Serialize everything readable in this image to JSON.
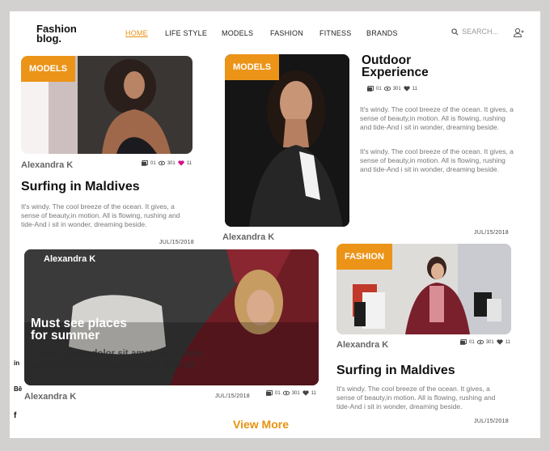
{
  "logo": {
    "line1": "Fashion",
    "line2": "blog."
  },
  "nav": [
    "HOME",
    "LIFE STYLE",
    "MODELS",
    "FASHION",
    "FITNESS",
    "BRANDS"
  ],
  "search": {
    "placeholder": "SEARCH..."
  },
  "colors": {
    "accent": "#eb9418",
    "like": "#d6118c"
  },
  "posts": {
    "p1": {
      "badge": "MODELS",
      "author": "Alexandra K",
      "photos": "01",
      "views": "301",
      "likes": "11",
      "title": "Surfing in Maldives",
      "excerpt": "It's windy. The cool breeze of the ocean. It gives, a sense of beauty,in motion. All is flowing, rushing and tide-And i sit in wonder, dreaming beside.",
      "date": "JUL/15/2018"
    },
    "p2": {
      "badge": "MODELS",
      "author": "Alexandra K",
      "title1": "Outdoor",
      "title2": "Experience",
      "photos": "01",
      "views": "301",
      "likes": "11",
      "excerpt1": "It's windy. The cool breeze of the ocean. It gives, a sense of beauty,in motion. All is flowing, rushing and tide-And i sit in wonder, dreaming beside.",
      "excerpt2": "It's windy. The cool breeze of the ocean. It gives, a sense of beauty,in motion. All is flowing, rushing and tide-And i sit in wonder, dreaming beside.",
      "date": "JUL/15/2018"
    },
    "p3": {
      "overlay_author": "Alexandra K",
      "headline1": "Must see places",
      "headline2": "for summer",
      "lorem1": "Lorem ipsum dolor sit amet consetetur",
      "lorem2": "adipiscing elit nullam aliquea dam sit",
      "author": "Alexandra K",
      "date": "JUL/15/2018",
      "photos": "01",
      "views": "301",
      "likes": "11"
    },
    "p4": {
      "badge": "FASHION",
      "author": "Alexandra K",
      "photos": "01",
      "views": "301",
      "likes": "11",
      "title": "Surfing in Maldives",
      "excerpt": "It's windy. The cool breeze of the ocean. It gives, a sense of beauty,in motion. All is flowing, rushing and tide-And i sit in wonder, dreaming beside.",
      "date": "JUL/15/2018"
    }
  },
  "social": {
    "linkedin": "in",
    "behance": "Bē",
    "facebook": "f"
  },
  "view_more": "View More"
}
